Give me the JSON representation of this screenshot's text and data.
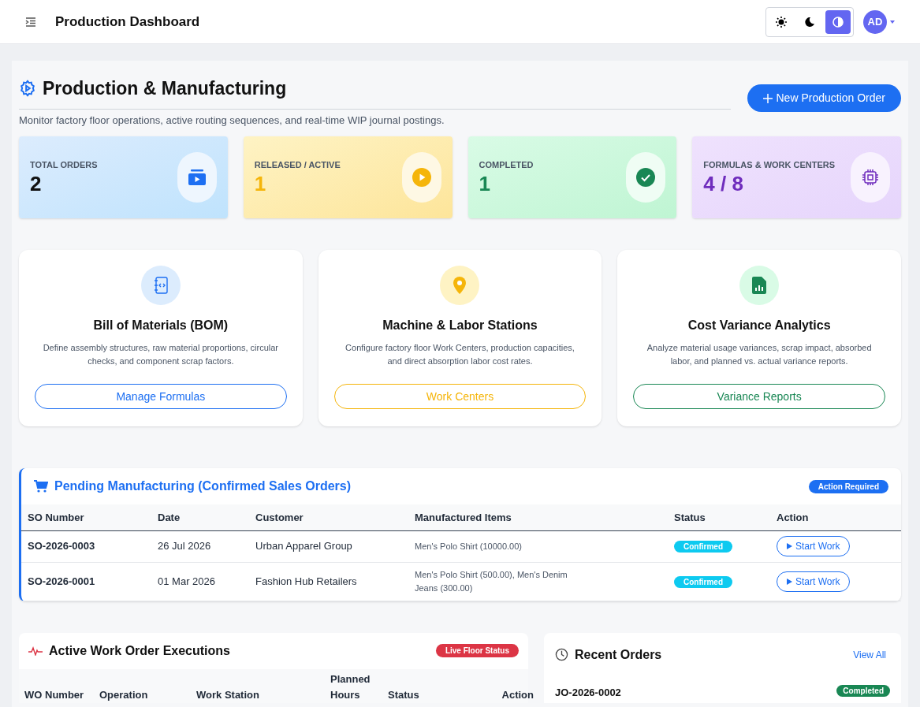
{
  "header": {
    "title": "Production Dashboard",
    "theme_modes": [
      {
        "kind": "light",
        "selected": false
      },
      {
        "kind": "dark",
        "selected": false
      },
      {
        "kind": "auto",
        "selected": true
      }
    ],
    "avatar": "AD"
  },
  "page": {
    "title": "Production & Manufacturing",
    "subtitle": "Monitor factory floor operations, active routing sequences, and real-time WIP journal postings.",
    "new_button": "New Production Order"
  },
  "stats": [
    {
      "label": "TOTAL ORDERS",
      "value": "2",
      "kind": "total"
    },
    {
      "label": "RELEASED / ACTIVE",
      "value": "1",
      "kind": "active"
    },
    {
      "label": "COMPLETED",
      "value": "1",
      "kind": "completed"
    },
    {
      "label": "FORMULAS & WORK CENTERS",
      "value": "4 / 8",
      "kind": "formulas"
    }
  ],
  "features": [
    {
      "kind": "bom",
      "title": "Bill of Materials (BOM)",
      "description": "Define assembly structures, raw material proportions, circular checks, and component scrap factors.",
      "button": "Manage Formulas"
    },
    {
      "kind": "stations",
      "title": "Machine & Labor Stations",
      "description": "Configure factory floor Work Centers, production capacities, and direct absorption labor cost rates.",
      "button": "Work Centers"
    },
    {
      "kind": "variance",
      "title": "Cost Variance Analytics",
      "description": "Analyze material usage variances, scrap impact, absorbed labor, and planned vs. actual variance reports.",
      "button": "Variance Reports"
    }
  ],
  "pending": {
    "title": "Pending Manufacturing (Confirmed Sales Orders)",
    "badge": "Action Required",
    "columns": [
      "SO Number",
      "Date",
      "Customer",
      "Manufactured Items",
      "Status",
      "Action"
    ],
    "rows": [
      {
        "so": "SO-2026-0003",
        "date": "26 Jul 2026",
        "customer": "Urban Apparel Group",
        "items": "Men's Polo Shirt (10000.00)",
        "status": "Confirmed",
        "action": "Start Work"
      },
      {
        "so": "SO-2026-0001",
        "date": "01 Mar 2026",
        "customer": "Fashion Hub Retailers",
        "items": "Men's Polo Shirt (500.00), Men's Denim Jeans (300.00)",
        "status": "Confirmed",
        "action": "Start Work"
      }
    ]
  },
  "work_orders": {
    "title": "Active Work Order Executions",
    "badge": "Live Floor Status",
    "columns": [
      "WO Number",
      "Operation",
      "Work Station",
      "Planned Hours",
      "Status",
      "Action"
    ]
  },
  "recent": {
    "title": "Recent Orders",
    "link": "View All",
    "orders": [
      {
        "number": "JO-2026-0002",
        "status": "Completed"
      }
    ]
  }
}
